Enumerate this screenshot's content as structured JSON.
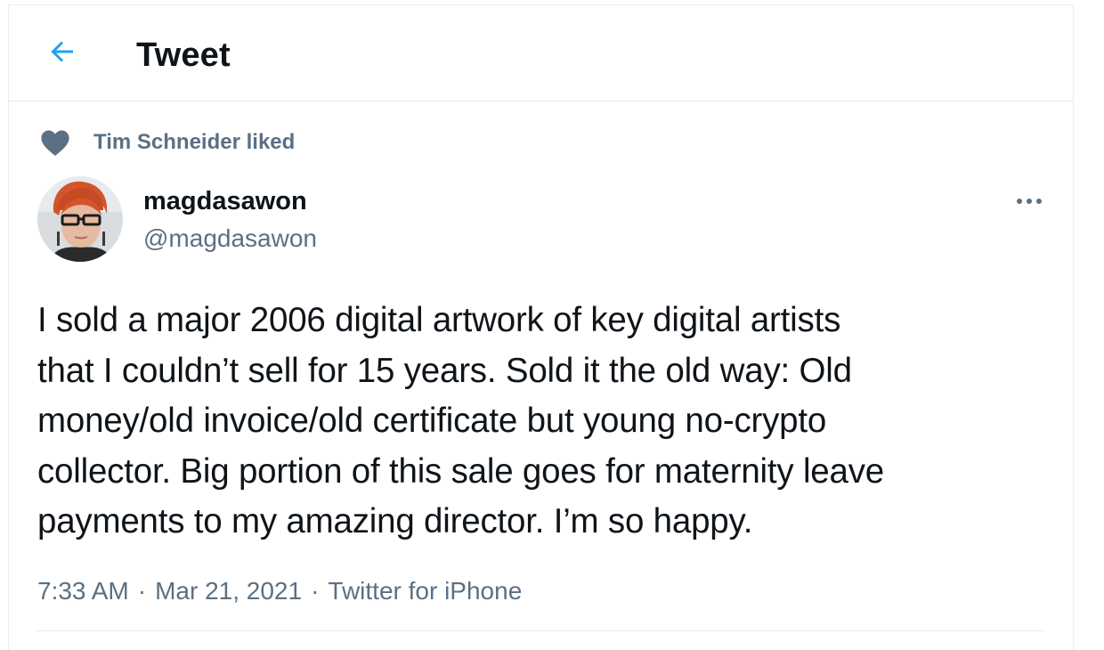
{
  "header": {
    "title": "Tweet",
    "back_icon": "arrow-left-icon",
    "accent_color": "#1da1f2"
  },
  "social_context": {
    "icon": "heart-icon",
    "text": "Tim Schneider liked"
  },
  "tweet": {
    "display_name": "magdasawon",
    "handle": "@magdasawon",
    "text": "I sold a major 2006 digital artwork of key digital artists\nthat I couldn’t sell for 15 years. Sold it the old way: Old\nmoney/old invoice/old certificate but young no-crypto\ncollector. Big portion of this sale goes for maternity leave\npayments to my amazing director. I’m so happy.",
    "time": "7:33 AM",
    "separator": "·",
    "date": "Mar 21, 2021",
    "source": "Twitter for iPhone",
    "more_icon": "more-horizontal-icon"
  },
  "colors": {
    "text_primary": "#0f1419",
    "text_secondary": "#5b7083",
    "border": "#e6ecf0"
  }
}
